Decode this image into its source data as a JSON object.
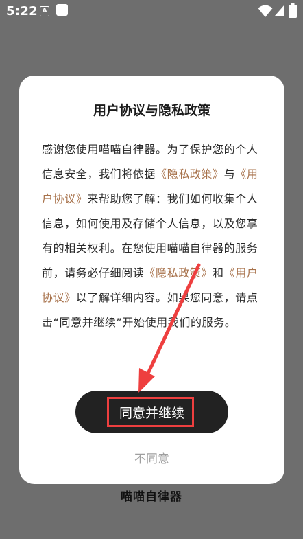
{
  "status_bar": {
    "time": "5:22",
    "a_icon_letter": "A",
    "icons": [
      "a-box-icon",
      "square-icon",
      "wifi-icon",
      "signal-icon",
      "battery-icon"
    ]
  },
  "dialog": {
    "title": "用户协议与隐私政策",
    "body": {
      "part1": "感谢您使用喵喵自律器。为了保护您的个人信息安全，我们将依据",
      "link1": "《隐私政策》",
      "part2": "与",
      "link2": "《用户协议》",
      "part3": "来帮助您了解：我们如何收集个人信息，如何使用及存储个人信息，以及您享有的相关权利。在您使用喵喵自律器的服务前，请务必仔细阅读",
      "link3": "《隐私政策》",
      "part4": "和",
      "link4": "《用户协议》",
      "part5": "以了解详细内容。如果您同意，请点击“同意并继续”开始使用我们的服务。"
    },
    "agree_label": "同意并继续",
    "disagree_label": "不同意"
  },
  "background": {
    "app_name": "喵喵自律器"
  },
  "colors": {
    "overlay_background": "#6e6e6e",
    "dialog_background": "#ffffff",
    "link": "#a7714a",
    "primary_button": "#222222",
    "disagree_text": "#9f9f9f",
    "annotation": "#ee3f3f"
  }
}
